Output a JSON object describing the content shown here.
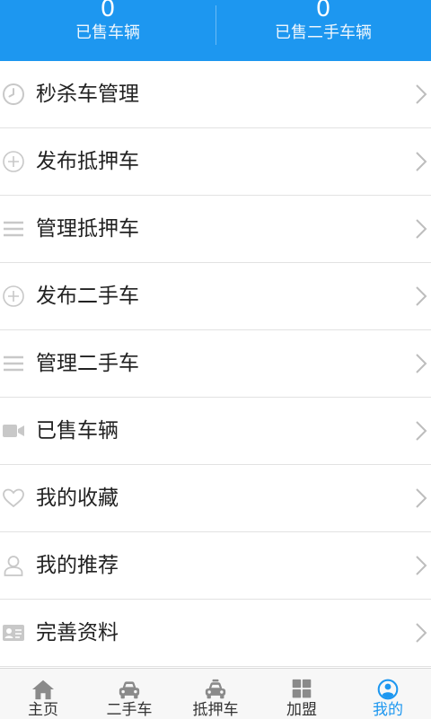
{
  "colors": {
    "accent": "#1d97f0",
    "icon_gray": "#c8c8c8",
    "tab_icon_gray": "#8a8a8a",
    "divider": "#e2e2e2"
  },
  "stats": [
    {
      "value": "0",
      "label": "已售车辆"
    },
    {
      "value": "0",
      "label": "已售二手车辆"
    }
  ],
  "menu": [
    {
      "label": "秒杀车管理",
      "icon": "clock-icon"
    },
    {
      "label": "发布抵押车",
      "icon": "plus-circle-icon"
    },
    {
      "label": "管理抵押车",
      "icon": "list-icon"
    },
    {
      "label": "发布二手车",
      "icon": "plus-circle-icon"
    },
    {
      "label": "管理二手车",
      "icon": "list-icon"
    },
    {
      "label": "已售车辆",
      "icon": "video-camera-icon"
    },
    {
      "label": "我的收藏",
      "icon": "heart-icon"
    },
    {
      "label": "我的推荐",
      "icon": "user-icon"
    },
    {
      "label": "完善资料",
      "icon": "id-card-icon"
    }
  ],
  "tabs": [
    {
      "label": "主页",
      "icon": "home-icon",
      "active": false
    },
    {
      "label": "二手车",
      "icon": "car-icon",
      "active": false
    },
    {
      "label": "抵押车",
      "icon": "taxi-icon",
      "active": false
    },
    {
      "label": "加盟",
      "icon": "grid-icon",
      "active": false
    },
    {
      "label": "我的",
      "icon": "profile-icon",
      "active": true
    }
  ]
}
